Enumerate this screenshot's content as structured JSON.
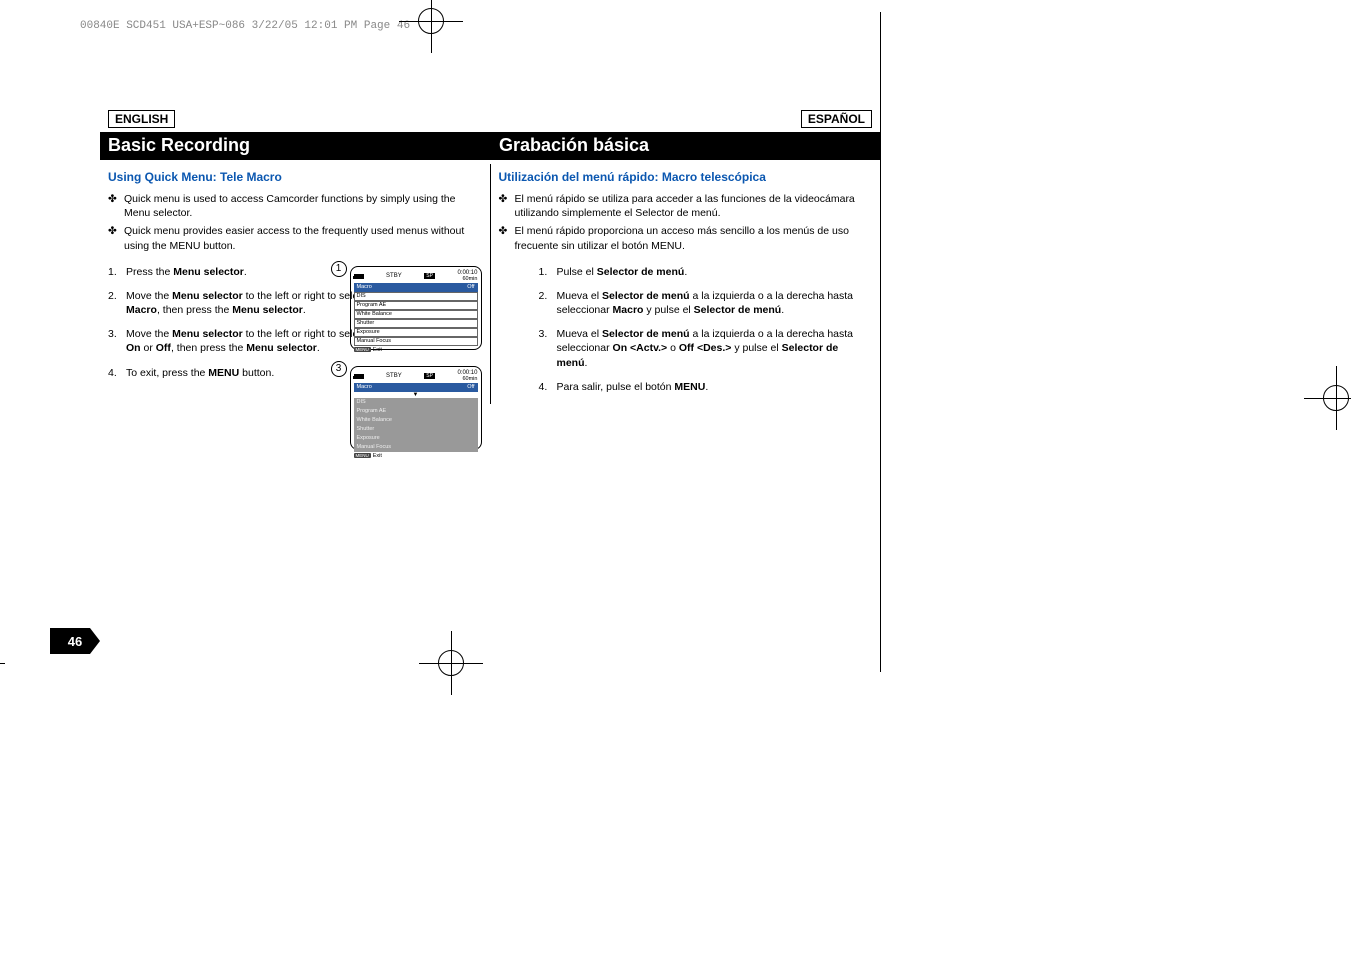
{
  "header_line": "00840E SCD451 USA+ESP~086  3/22/05 12:01 PM  Page 46",
  "lang_en": "ENGLISH",
  "lang_es": "ESPAÑOL",
  "title_en": "Basic Recording",
  "title_es": "Grabación básica",
  "section_en": "Using Quick Menu: Tele Macro",
  "section_es": "Utilización del menú rápido: Macro telescópica",
  "en_bullets": [
    "Quick menu is used to access Camcorder functions by simply using the Menu selector.",
    "Quick menu provides easier access to the frequently used menus without using the MENU button."
  ],
  "es_bullets": [
    "El menú rápido se utiliza para acceder a las funciones de la videocámara utilizando simplemente el Selector de menú.",
    "El menú rápido proporciona un acceso más sencillo a los menús de uso frecuente sin utilizar el botón MENU."
  ],
  "en_steps": [
    {
      "num": "1.",
      "text_pre": "Press the ",
      "bold1": "Menu selector",
      "text_post": "."
    },
    {
      "num": "2.",
      "text_pre": "Move the ",
      "bold1": "Menu selector",
      "text_mid": " to the left or right to select ",
      "bold2": "Macro",
      "text_mid2": ", then press the ",
      "bold3": "Menu selector",
      "text_post": "."
    },
    {
      "num": "3.",
      "text_pre": "Move the ",
      "bold1": "Menu selector",
      "text_mid": " to the left or right to select ",
      "bold2": "On",
      "text_mid2": " or ",
      "bold3": "Off",
      "text_mid3": ", then press the ",
      "bold4": "Menu selector",
      "text_post": "."
    },
    {
      "num": "4.",
      "text_pre": "To exit, press the ",
      "bold1": "MENU",
      "text_post": " button."
    }
  ],
  "es_steps": [
    {
      "num": "1.",
      "text_pre": "Pulse el ",
      "bold1": "Selector de menú",
      "text_post": "."
    },
    {
      "num": "2.",
      "text_pre": "Mueva el ",
      "bold1": "Selector de menú",
      "text_mid": " a la izquierda o a la derecha hasta seleccionar ",
      "bold2": "Macro",
      "text_mid2": " y pulse el ",
      "bold3": "Selector de menú",
      "text_post": "."
    },
    {
      "num": "3.",
      "text_pre": "Mueva el ",
      "bold1": "Selector de menú",
      "text_mid": " a la izquierda o a la derecha hasta seleccionar ",
      "bold2": "On <Actv.>",
      "text_mid2": " o ",
      "bold3": "Off <Des.>",
      "text_mid3": " y pulse el ",
      "bold4": "Selector de menú",
      "text_post": "."
    },
    {
      "num": "4.",
      "text_pre": "Para salir, pulse el botón ",
      "bold1": "MENU",
      "text_post": "."
    }
  ],
  "screen": {
    "stby": "STBY",
    "sp": "SP",
    "time": "0:00:10",
    "batt_time": "60min",
    "menu_items": [
      "Macro",
      "DIS",
      "Program AE",
      "White Balance",
      "Shutter",
      "Exposure",
      "Manual Focus"
    ],
    "macro_val_off": "Off",
    "menu_label": "MENU",
    "exit": "Exit"
  },
  "step_circles": {
    "one": "1",
    "three": "3"
  },
  "page_number": "46"
}
